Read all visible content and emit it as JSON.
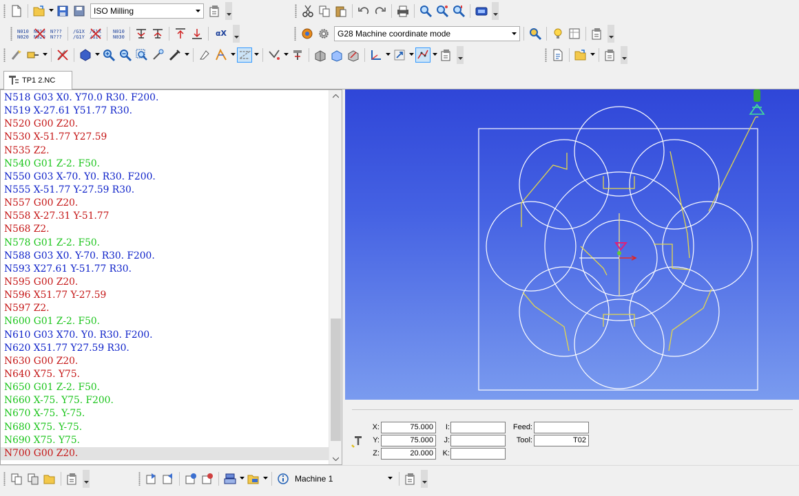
{
  "toolbar1": {
    "machine_type_value": "ISO Milling"
  },
  "toolbar2": {
    "coordinate_mode_value": "G28 Machine coordinate mode",
    "clear_x_label": "αX"
  },
  "tab": {
    "label": "TP1 2.NC"
  },
  "editor": {
    "lines": [
      {
        "text": "N518 G03 X0. Y70.0 R30. F200.",
        "color": "blue"
      },
      {
        "text": "N519 X-27.61 Y51.77 R30.",
        "color": "blue"
      },
      {
        "text": "N520 G00 Z20.",
        "color": "red"
      },
      {
        "text": "N530 X-51.77 Y27.59",
        "color": "red"
      },
      {
        "text": "N535 Z2.",
        "color": "red"
      },
      {
        "text": "N540 G01 Z-2. F50.",
        "color": "green"
      },
      {
        "text": "N550 G03 X-70. Y0. R30. F200.",
        "color": "blue"
      },
      {
        "text": "N555 X-51.77 Y-27.59 R30.",
        "color": "blue"
      },
      {
        "text": "N557 G00 Z20.",
        "color": "red"
      },
      {
        "text": "N558 X-27.31 Y-51.77",
        "color": "red"
      },
      {
        "text": "N568 Z2.",
        "color": "red"
      },
      {
        "text": "N578 G01 Z-2. F50.",
        "color": "green"
      },
      {
        "text": "N588 G03 X0. Y-70. R30. F200.",
        "color": "blue"
      },
      {
        "text": "N593 X27.61 Y-51.77 R30.",
        "color": "blue"
      },
      {
        "text": "N595 G00 Z20.",
        "color": "red"
      },
      {
        "text": "N596 X51.77 Y-27.59",
        "color": "red"
      },
      {
        "text": "N597 Z2.",
        "color": "red"
      },
      {
        "text": "N600 G01 Z-2. F50.",
        "color": "green"
      },
      {
        "text": "N610 G03 X70. Y0. R30. F200.",
        "color": "blue"
      },
      {
        "text": "N620 X51.77 Y27.59 R30.",
        "color": "blue"
      },
      {
        "text": "N630 G00 Z20.",
        "color": "red"
      },
      {
        "text": "N640 X75. Y75.",
        "color": "red"
      },
      {
        "text": "N650 G01 Z-2. F50.",
        "color": "green"
      },
      {
        "text": "N660 X-75. Y75. F200.",
        "color": "green"
      },
      {
        "text": "N670 X-75. Y-75.",
        "color": "green"
      },
      {
        "text": "N680 X75. Y-75.",
        "color": "green"
      },
      {
        "text": "N690 X75. Y75.",
        "color": "green"
      },
      {
        "text": "N700 G00 Z20.",
        "color": "red",
        "current": true
      }
    ],
    "colors": {
      "blue": "#0a1ec8",
      "red": "#c41414",
      "green": "#19c419"
    }
  },
  "viewport": {
    "background_top": "#2f46d8",
    "background_bottom": "#7a9bef",
    "toolpath_color": "#ffffff",
    "rapid_color": "#e6d84a"
  },
  "coords": {
    "x_label": "X:",
    "x_value": "75.000",
    "y_label": "Y:",
    "y_value": "75.000",
    "z_label": "Z:",
    "z_value": "20.000",
    "i_label": "I:",
    "i_value": "",
    "j_label": "J:",
    "j_value": "",
    "k_label": "K:",
    "k_value": "",
    "feed_label": "Feed:",
    "feed_value": "",
    "tool_label": "Tool:",
    "tool_value": "T02"
  },
  "bottombar": {
    "machine_value": "Machine 1"
  }
}
